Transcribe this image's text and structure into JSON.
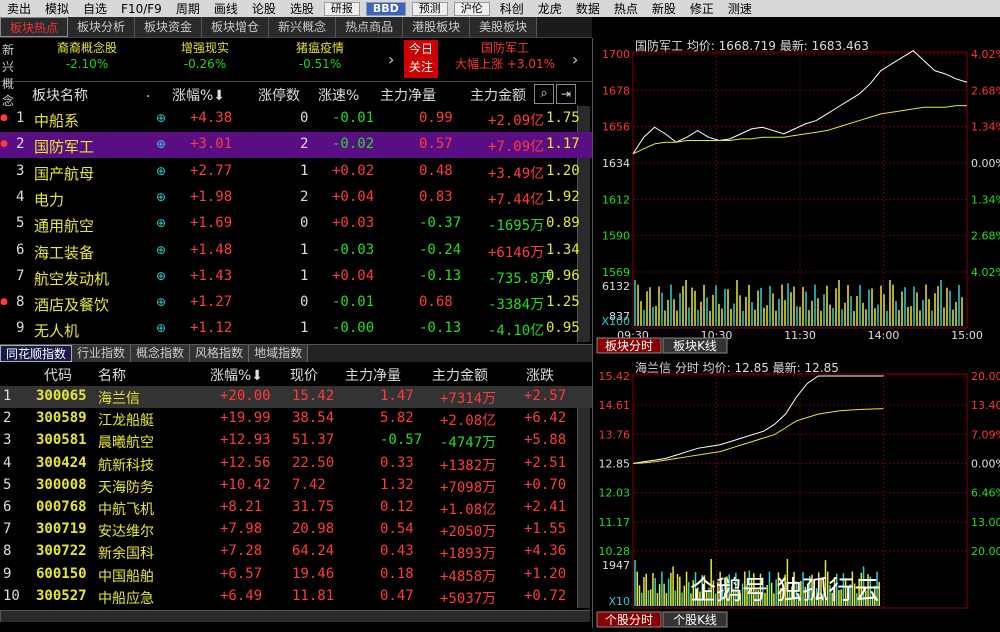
{
  "menubar": [
    "卖出",
    "模拟",
    "自选",
    "F10/F9",
    "周期",
    "画线",
    "论股",
    "选股",
    "研报",
    "BBD",
    "预测",
    "沪伦",
    "科创",
    "龙虎",
    "数据",
    "热点",
    "新股",
    "修正",
    "测速"
  ],
  "tabs": [
    "板块热点",
    "板块分析",
    "板块资金",
    "板块增仓",
    "新兴概念",
    "热点商品",
    "港股板块",
    "美股板块"
  ],
  "concept_bar": {
    "left_label": "新兴\n概念",
    "items": [
      {
        "name": "裔裔概念股",
        "pct": "-2.10%"
      },
      {
        "name": "增强现实",
        "pct": "-0.26%"
      },
      {
        "name": "猪瘟疫情",
        "pct": "-0.51%"
      }
    ],
    "arrow": "›",
    "today_label": "今日\n关注",
    "focus": {
      "name": "国防军工",
      "sub": "大幅上涨",
      "pct": "+3.01%"
    }
  },
  "sector_table": {
    "headers": [
      "板块名称",
      ".",
      "涨幅%⬇",
      "涨停数",
      "涨速%",
      "主力净量",
      "主力金额"
    ],
    "rows": [
      {
        "no": "1",
        "name": "中船系",
        "pct": "+4.38",
        "limit": "0",
        "speed": "-0.01",
        "net": "0.99",
        "amt": "+2.09亿",
        "last": "1.75"
      },
      {
        "no": "2",
        "name": "国防军工",
        "pct": "+3.01",
        "limit": "2",
        "speed": "-0.02",
        "net": "0.57",
        "amt": "+7.09亿",
        "last": "1.17"
      },
      {
        "no": "3",
        "name": "国产航母",
        "pct": "+2.77",
        "limit": "1",
        "speed": "+0.02",
        "net": "0.48",
        "amt": "+3.49亿",
        "last": "1.20"
      },
      {
        "no": "4",
        "name": "电力",
        "pct": "+1.98",
        "limit": "2",
        "speed": "+0.04",
        "net": "0.83",
        "amt": "+7.44亿",
        "last": "1.92"
      },
      {
        "no": "5",
        "name": "通用航空",
        "pct": "+1.69",
        "limit": "0",
        "speed": "+0.03",
        "net": "-0.37",
        "amt": "-1695万",
        "last": "0.89"
      },
      {
        "no": "6",
        "name": "海工装备",
        "pct": "+1.48",
        "limit": "1",
        "speed": "-0.03",
        "net": "-0.24",
        "amt": "+6146万",
        "last": "1.34"
      },
      {
        "no": "7",
        "name": "航空发动机",
        "pct": "+1.43",
        "limit": "1",
        "speed": "+0.04",
        "net": "-0.13",
        "amt": "-735.8万",
        "last": "0.96"
      },
      {
        "no": "8",
        "name": "酒店及餐饮",
        "pct": "+1.27",
        "limit": "0",
        "speed": "-0.01",
        "net": "0.68",
        "amt": "-3384万",
        "last": "1.25"
      },
      {
        "no": "9",
        "name": "无人机",
        "pct": "+1.12",
        "limit": "1",
        "speed": "-0.00",
        "net": "-0.13",
        "amt": "-4.10亿",
        "last": "0.95"
      }
    ]
  },
  "tabs2": [
    "同花顺指数",
    "行业指数",
    "概念指数",
    "风格指数",
    "地域指数"
  ],
  "stock_table": {
    "headers": [
      "代码",
      "名称",
      "涨幅%⬇",
      "现价",
      "主力净量",
      "主力金额",
      "涨跌"
    ],
    "rows": [
      {
        "no": "1",
        "code": "300065",
        "name": "海兰信",
        "pct": "+20.00",
        "price": "15.42",
        "net": "1.47",
        "amt": "+7314万",
        "chg": "+2.57"
      },
      {
        "no": "2",
        "code": "300589",
        "name": "江龙船艇",
        "pct": "+19.99",
        "price": "38.54",
        "net": "5.82",
        "amt": "+2.08亿",
        "chg": "+6.42"
      },
      {
        "no": "3",
        "code": "300581",
        "name": "晨曦航空",
        "pct": "+12.93",
        "price": "51.37",
        "net": "-0.57",
        "amt": "-4747万",
        "chg": "+5.88"
      },
      {
        "no": "4",
        "code": "300424",
        "name": "航新科技",
        "pct": "+12.56",
        "price": "22.50",
        "net": "0.33",
        "amt": "+1382万",
        "chg": "+2.51"
      },
      {
        "no": "5",
        "code": "300008",
        "name": "天海防务",
        "pct": "+10.42",
        "price": "7.42",
        "net": "1.32",
        "amt": "+7098万",
        "chg": "+0.70"
      },
      {
        "no": "6",
        "code": "000768",
        "name": "中航飞机",
        "pct": "+8.21",
        "price": "31.75",
        "net": "0.12",
        "amt": "+1.08亿",
        "chg": "+2.41"
      },
      {
        "no": "7",
        "code": "300719",
        "name": "安达维尔",
        "pct": "+7.98",
        "price": "20.98",
        "net": "0.54",
        "amt": "+2050万",
        "chg": "+1.55"
      },
      {
        "no": "8",
        "code": "300722",
        "name": "新余国科",
        "pct": "+7.28",
        "price": "64.24",
        "net": "0.43",
        "amt": "+1893万",
        "chg": "+4.36"
      },
      {
        "no": "9",
        "code": "600150",
        "name": "中国船舶",
        "pct": "+6.57",
        "price": "19.46",
        "net": "0.18",
        "amt": "+4858万",
        "chg": "+1.20"
      },
      {
        "no": "10",
        "code": "300527",
        "name": "中船应急",
        "pct": "+6.49",
        "price": "11.81",
        "net": "0.47",
        "amt": "+5037万",
        "chg": "+0.72"
      }
    ]
  },
  "chart_data": [
    {
      "type": "line",
      "title": "国防军工",
      "avg_label": "均价: 1668.719",
      "last_label": "最新: 1683.463",
      "yticks": [
        "1700",
        "1678",
        "1656",
        "1634",
        "1612",
        "1590",
        "1569"
      ],
      "pct_ticks": [
        "4.02%",
        "2.68%",
        "1.34%",
        "0.00%",
        "1.34%",
        "2.68%",
        "4.02%"
      ],
      "xticks": [
        "09:30",
        "10:30",
        "11:30",
        "14:00",
        "15:00"
      ],
      "vol_labels": [
        "6132",
        "837",
        "X100"
      ],
      "price": [
        1640,
        1650,
        1656,
        1652,
        1647,
        1650,
        1654,
        1650,
        1648,
        1649,
        1652,
        1655,
        1656,
        1654,
        1652,
        1655,
        1658,
        1660,
        1664,
        1668,
        1672,
        1676,
        1682,
        1690,
        1694,
        1698,
        1702,
        1696,
        1690,
        1688,
        1685,
        1683
      ],
      "avg": [
        1640,
        1643,
        1646,
        1647,
        1647,
        1648,
        1648,
        1648,
        1648,
        1648,
        1649,
        1649,
        1650,
        1650,
        1650,
        1651,
        1652,
        1653,
        1654,
        1656,
        1658,
        1660,
        1662,
        1664,
        1665,
        1666,
        1667,
        1668,
        1668,
        1668,
        1669,
        1669
      ],
      "bottom_tabs": [
        "板块分时",
        "板块K线"
      ]
    },
    {
      "type": "line",
      "title": "海兰信",
      "sub": "分时",
      "avg_label": "均价: 12.85",
      "last_label": "最新: 12.85",
      "yticks": [
        "15.42",
        "14.61",
        "13.76",
        "12.85",
        "12.03",
        "11.17",
        "10.28"
      ],
      "pct_ticks": [
        "20.00%",
        "13.40%",
        "7.09%",
        "0.00%",
        "6.46%",
        "13.00%",
        "20.00%"
      ],
      "vol_labels": [
        "1947",
        "X10"
      ],
      "price": [
        12.85,
        12.9,
        12.95,
        13.0,
        13.1,
        13.2,
        13.3,
        13.35,
        13.4,
        13.5,
        13.6,
        13.7,
        13.8,
        14.0,
        14.3,
        14.8,
        15.2,
        15.42,
        15.42,
        15.42,
        15.42,
        15.42,
        15.42,
        15.42
      ],
      "avg": [
        12.85,
        12.87,
        12.9,
        12.95,
        13.0,
        13.05,
        13.1,
        13.15,
        13.2,
        13.3,
        13.4,
        13.5,
        13.6,
        13.7,
        13.9,
        14.1,
        14.2,
        14.3,
        14.35,
        14.4,
        14.42,
        14.44,
        14.45,
        14.46
      ],
      "bottom_tabs": [
        "个股分时",
        "个股K线"
      ]
    }
  ],
  "watermark": "企鹅号 独孤行云"
}
